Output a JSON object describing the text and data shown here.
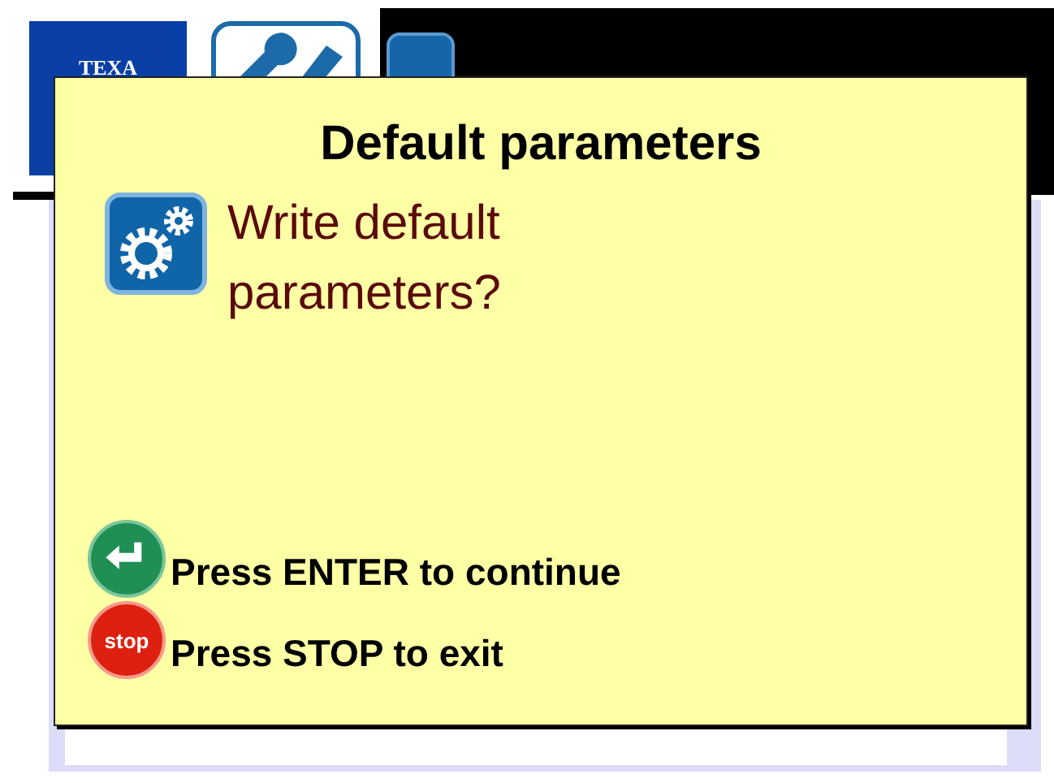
{
  "header": {
    "logo": "TEXA"
  },
  "dialog": {
    "title": "Default parameters",
    "message": "Write default parameters?",
    "hints": [
      {
        "kind": "enter",
        "text": "Press ENTER to continue"
      },
      {
        "kind": "stop",
        "key_label": "stop",
        "text": "Press STOP to exit"
      }
    ]
  }
}
